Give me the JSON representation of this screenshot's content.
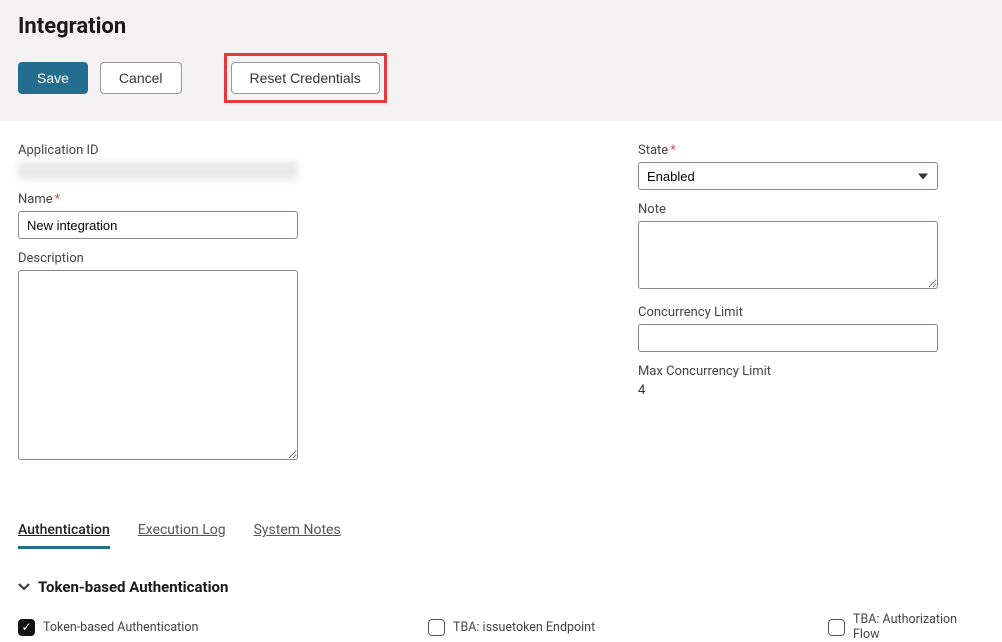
{
  "header": {
    "title": "Integration",
    "save_label": "Save",
    "cancel_label": "Cancel",
    "reset_label": "Reset Credentials"
  },
  "left": {
    "app_id_label": "Application ID",
    "app_id_value": "",
    "name_label": "Name",
    "name_value": "New integration",
    "description_label": "Description",
    "description_value": ""
  },
  "right": {
    "state_label": "State",
    "state_value": "Enabled",
    "note_label": "Note",
    "note_value": "",
    "concurrency_label": "Concurrency Limit",
    "concurrency_value": "",
    "max_concurrency_label": "Max Concurrency Limit",
    "max_concurrency_value": "4"
  },
  "tabs": [
    {
      "label": "Authentication",
      "active": true
    },
    {
      "label": "Execution Log",
      "active": false
    },
    {
      "label": "System Notes",
      "active": false
    }
  ],
  "auth_section": {
    "title": "Token-based Authentication",
    "checkboxes": [
      {
        "label": "Token-based Authentication",
        "checked": true
      },
      {
        "label": "TBA: issuetoken Endpoint",
        "checked": false
      },
      {
        "label": "TBA: Authorization Flow",
        "checked": false
      }
    ]
  }
}
